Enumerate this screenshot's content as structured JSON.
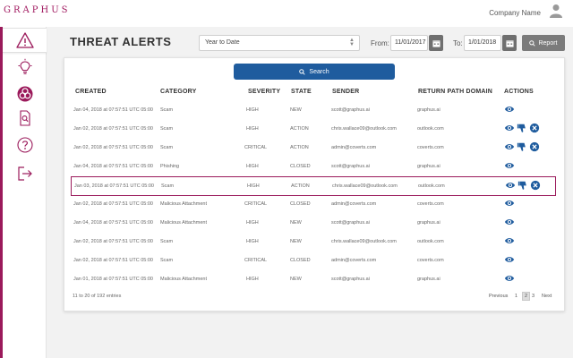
{
  "app": {
    "logo": "GRAPHUS",
    "company": "Company Name"
  },
  "sidebar": {
    "items": [
      {
        "name": "threat-alerts",
        "icon": "warning-icon"
      },
      {
        "name": "insights",
        "icon": "lightbulb-icon"
      },
      {
        "name": "biohazard",
        "icon": "biohazard-icon"
      },
      {
        "name": "reports",
        "icon": "document-search-icon"
      },
      {
        "name": "help",
        "icon": "question-icon"
      },
      {
        "name": "logout",
        "icon": "logout-icon"
      }
    ],
    "accent": "#9b1a5b"
  },
  "header": {
    "title": "THREAT ALERTS",
    "range": "Year to Date",
    "from_label": "From:",
    "from_value": "11/01/2017",
    "to_label": "To:",
    "to_value": "1/01/2018",
    "report_label": "Report"
  },
  "search": {
    "label": "Search",
    "color": "#1f5c9e"
  },
  "table": {
    "columns": [
      "CREATED",
      "CATEGORY",
      "SEVERITY",
      "STATE",
      "SENDER",
      "RETURN PATH DOMAIN",
      "ACTIONS"
    ],
    "rows": [
      {
        "created": "Jan 04, 2018 at 07:57:51   UTC 05:00",
        "category": "Scam",
        "severity": "HIGH",
        "state": "NEW",
        "sender": "scott@graphus.ai",
        "domain": "graphus.ai",
        "actions": [
          "view"
        ]
      },
      {
        "created": "Jan 02, 2018 at 07:57:51   UTC 05:00",
        "category": "Scam",
        "severity": "HIGH",
        "state": "ACTION",
        "sender": "chris.wallace09@outlook.com",
        "domain": "outlook.com",
        "actions": [
          "view",
          "dislike",
          "dismiss"
        ]
      },
      {
        "created": "Jan 02, 2018 at 07:57:51   UTC 05:00",
        "category": "Scam",
        "severity": "CRITICAL",
        "state": "ACTION",
        "sender": "admin@coverts.com",
        "domain": "coverts.com",
        "actions": [
          "view",
          "dislike",
          "dismiss"
        ]
      },
      {
        "created": "Jan 04, 2018 at 07:57:51   UTC 05:00",
        "category": "Phishing",
        "severity": "HIGH",
        "state": "CLOSED",
        "sender": "scott@graphus.ai",
        "domain": "graphus.ai",
        "actions": [
          "view"
        ]
      },
      {
        "created": "Jan 03, 2018 at 07:57:51   UTC 05:00",
        "category": "Scam",
        "severity": "HIGH",
        "state": "ACTION",
        "sender": "chris.wallace09@outlook.com",
        "domain": "outlook.com",
        "actions": [
          "view",
          "dislike",
          "dismiss"
        ]
      },
      {
        "created": "Jan 02, 2018 at 07:57:51   UTC 05:00",
        "category": "Malicious Attachment",
        "severity": "CRITICAL",
        "state": "CLOSED",
        "sender": "admin@coverts.com",
        "domain": "coverts.com",
        "actions": [
          "view"
        ]
      },
      {
        "created": "Jan 04, 2018 at 07:57:51   UTC 05:00",
        "category": "Malicious Attachment",
        "severity": "HIGH",
        "state": "NEW",
        "sender": "scott@graphus.ai",
        "domain": "graphus.ai",
        "actions": [
          "view"
        ]
      },
      {
        "created": "Jan 02, 2018 at 07:57:51   UTC 05:00",
        "category": "Scam",
        "severity": "HIGH",
        "state": "NEW",
        "sender": "chris.wallace09@outlook.com",
        "domain": "outlook.com",
        "actions": [
          "view"
        ]
      },
      {
        "created": "Jan 02, 2018 at 07:57:51   UTC 05:00",
        "category": "Scam",
        "severity": "CRITICAL",
        "state": "CLOSED",
        "sender": "admin@coverts.com",
        "domain": "coverts.com",
        "actions": [
          "view"
        ]
      },
      {
        "created": "Jan 01, 2018 at 07:57:51   UTC 05:00",
        "category": "Malicious Attachment",
        "severity": "HIGH",
        "state": "NEW",
        "sender": "scott@graphus.ai",
        "domain": "graphus.ai",
        "actions": [
          "view"
        ]
      }
    ],
    "selected_row": 4
  },
  "footer": {
    "entries": "11 to 20 of 192 entries",
    "pagination": {
      "previous": "Previous",
      "pages": [
        "1",
        "2",
        "3"
      ],
      "current": "2",
      "next": "Next"
    }
  }
}
